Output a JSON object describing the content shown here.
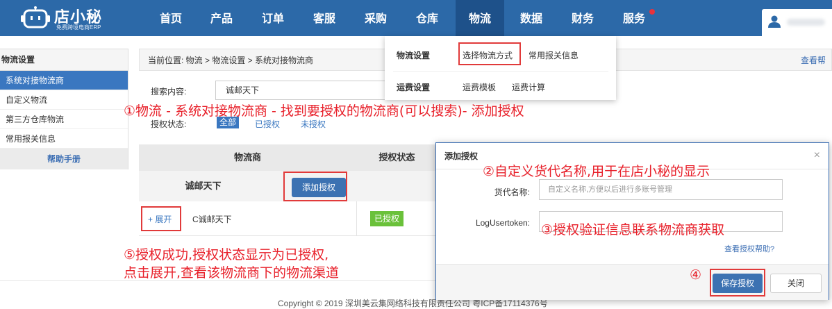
{
  "header": {
    "logo_title": "店小秘",
    "logo_subtitle": "免费跨境电商ERP",
    "nav": [
      {
        "label": "首页"
      },
      {
        "label": "产品"
      },
      {
        "label": "订单"
      },
      {
        "label": "客服"
      },
      {
        "label": "采购"
      },
      {
        "label": "仓库"
      },
      {
        "label": "物流"
      },
      {
        "label": "数据"
      },
      {
        "label": "财务"
      },
      {
        "label": "服务"
      }
    ],
    "active_nav": "物流"
  },
  "dropdown": {
    "sections": [
      {
        "title": "物流设置",
        "items": [
          "选择物流方式",
          "常用报关信息"
        ]
      },
      {
        "title": "运费设置",
        "items": [
          "运费模板",
          "运费计算"
        ]
      }
    ]
  },
  "sidebar": {
    "title": "物流设置",
    "items": [
      {
        "label": "系统对接物流商"
      },
      {
        "label": "自定义物流"
      },
      {
        "label": "第三方仓库物流"
      },
      {
        "label": "常用报关信息"
      }
    ],
    "help": "帮助手册"
  },
  "breadcrumb": {
    "text": "当前位置:  物流 > 物流设置 > 系统对接物流商",
    "help_link": "查看帮"
  },
  "search": {
    "label": "搜索内容:",
    "value": "诚邮天下",
    "status_label": "授权状态:",
    "filters": [
      "全部",
      "已授权",
      "未授权"
    ]
  },
  "table": {
    "headers": [
      "物流商",
      "授权状态"
    ],
    "group_name": "诚邮天下",
    "add_auth_button": "添加授权",
    "row": {
      "expand": "+ 展开",
      "name": "C诚邮天下",
      "status": "已授权"
    }
  },
  "modal": {
    "title": "添加授权",
    "close": "×",
    "fields": [
      {
        "label": "货代名称:",
        "placeholder": "自定义名称,方便以后进行多账号管理",
        "value": ""
      },
      {
        "label": "LogUsertoken:",
        "placeholder": "",
        "value": ""
      }
    ],
    "help_link": "查看授权帮助?",
    "save_button": "保存授权",
    "close_button": "关闭"
  },
  "annotations": {
    "a1": "①物流 - 系统对接物流商 - 找到要授权的物流商(可以搜索)- 添加授权",
    "a2": "②自定义货代名称,用于在店小秘的显示",
    "a3": "③授权验证信息联系物流商获取",
    "a4": "④",
    "a5_line1": "⑤授权成功,授权状态显示为已授权,",
    "a5_line2": "点击展开,查看该物流商下的物流渠道"
  },
  "footer": {
    "copyright": "Copyright © 2019 深圳美云集网络科技有限责任公司 粤ICP备17114376号"
  },
  "colors": {
    "nav_bg": "#2c69a8",
    "nav_active": "#1e518a",
    "accent": "#3a77c0",
    "annotation": "#e8202a",
    "success": "#6ac13a"
  }
}
